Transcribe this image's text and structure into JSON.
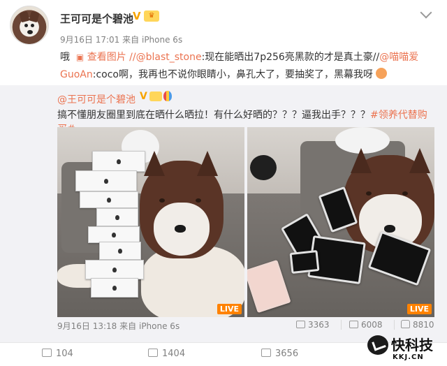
{
  "post": {
    "username": "王可可是个碧池",
    "verified": "V",
    "time": "9月16日 17:01",
    "source_prefix": "来自",
    "source": "iPhone 6s",
    "text_intro": "哦",
    "view_image": "查看图片",
    "text_mention1": "//@blast_stone",
    "text_body1": ":现在能晒出7p256亮黑款的才是真土豪//",
    "text_mention2": "@喵喵爱GuoAn",
    "text_body2": ":coco啊，我再也不说你眼睛小，鼻孔大了，要抽奖了，黑幕我呀"
  },
  "repost": {
    "author": "@王可可是个碧池",
    "verified": "V",
    "text": "搞不懂朋友圈里到底在晒什么晒拉！有什么好晒的？？？逼我出手？？？",
    "tag": "#领养代替购买#",
    "live_label": "LIVE",
    "time": "9月16日 13:18",
    "source_prefix": "来自",
    "source": "iPhone 6s",
    "reposts": "3363",
    "comments": "6008",
    "likes": "8810"
  },
  "actions": {
    "repost": "104",
    "comment": "1404",
    "like": "3656"
  },
  "watermark": {
    "name": "快科技",
    "url": "KKJ.CN"
  },
  "colors": {
    "link": "#eb7350",
    "verified": "#f7a400",
    "live": "#ff8200"
  }
}
